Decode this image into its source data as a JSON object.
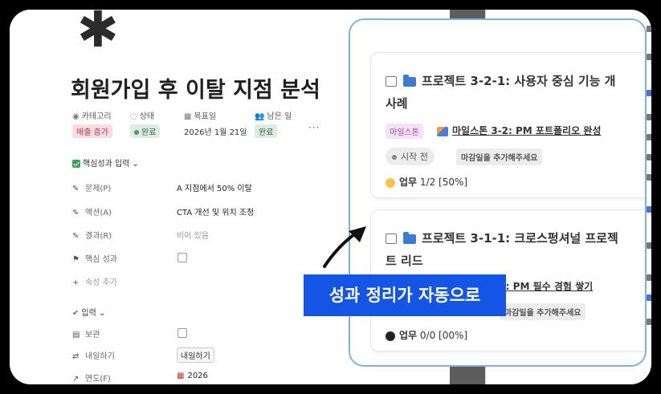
{
  "page": {
    "icon_glyph": "✱",
    "title": "회원가입 후 이탈 지점 분석",
    "property_headers": [
      {
        "icon": "◉",
        "label": "카테고리"
      },
      {
        "icon": "◌",
        "label": "상태"
      },
      {
        "icon": "▦",
        "label": "목표일"
      },
      {
        "icon": "👥",
        "label": "남은 일"
      }
    ],
    "category_tag": "매출 증가",
    "status_tag": "완료",
    "target_date": "2026년 1월 21일",
    "remaining_tag": "완료",
    "more": "···",
    "section_core": "핵심성과 입력 ⌄",
    "rows": [
      {
        "icon": "✎",
        "label": "문제(P)",
        "value": "A 지점에서 50% 이탈"
      },
      {
        "icon": "✎",
        "label": "액션(A)",
        "value": "CTA 개선 및 위치 조정"
      },
      {
        "icon": "✎",
        "label": "결과(R)",
        "value": "비어 있음"
      },
      {
        "icon": "⚑",
        "label": "핵심 성과",
        "value": ""
      }
    ],
    "add_property": "속성 추가",
    "section_input": "입력 ⌄",
    "rows2": [
      {
        "icon": "▤",
        "label": "보관"
      },
      {
        "icon": "⇄",
        "label": "내일하기",
        "button": "내일하기"
      },
      {
        "icon": "↗",
        "label": "연도(F)",
        "value": "2026"
      }
    ]
  },
  "cards": [
    {
      "title_line1": "프로젝트 3-2-1: 사용자 중심 기능 개",
      "title_line2": "사례",
      "milestone_tag": "마일스톤",
      "milestone_link": "마일스톤 3-2: PM 포트폴리오 완성",
      "status": "시작 전",
      "deadline": "마감일을 추가해주세요",
      "task_label": "업무",
      "task_progress": "1/2 [50%]",
      "task_color": "#f5c447"
    },
    {
      "title_line1": "프로젝트 3-1-1: 크로스펑셔널 프로젝",
      "title_line2": "트 리드",
      "milestone_link_partial": "3-1: PM 필수 경험 쌓기",
      "deadline": "마감일을 추가해주세요",
      "task_label": "업무",
      "task_progress": "0/0 [00%]",
      "task_color": "#222222"
    }
  ],
  "caption": "성과 정리가 자동으로",
  "colors": {
    "accent_blue": "#1455e6",
    "zoom_border": "#5cc6c4"
  }
}
